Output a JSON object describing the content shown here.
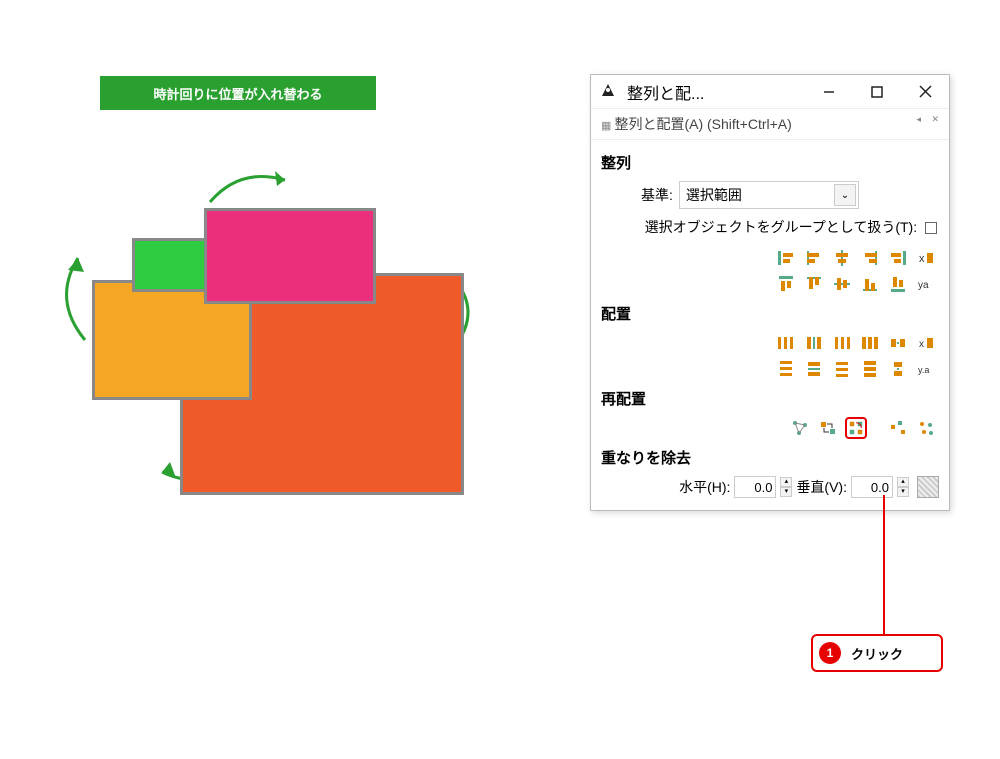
{
  "banner": {
    "text": "時計回りに位置が入れ替わる"
  },
  "dialog": {
    "title": "整列と配...",
    "sub_header": "整列と配置(A) (Shift+Ctrl+A)",
    "sections": {
      "align_label": "整列",
      "basis_label": "基準:",
      "basis_value": "選択範囲",
      "group_checkbox_label": "選択オブジェクトをグループとして扱う(T):",
      "distribute_label": "配置",
      "rearrange_label": "再配置",
      "overlap_label": "重なりを除去",
      "horiz_label": "水平(H):",
      "horiz_value": "0.0",
      "vert_label": "垂直(V):",
      "vert_value": "0.0"
    }
  },
  "callout": {
    "number": "1",
    "text": "クリック"
  }
}
